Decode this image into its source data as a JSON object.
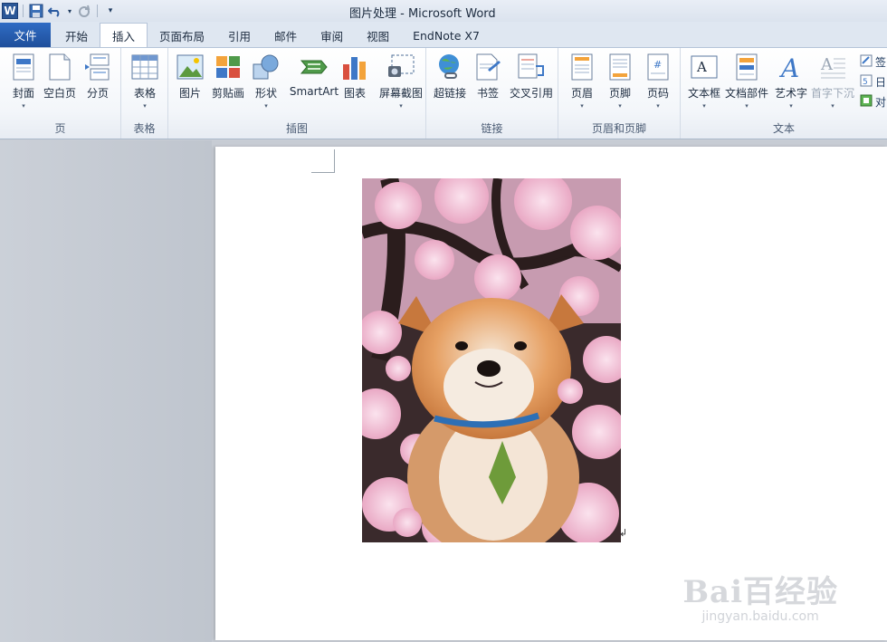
{
  "window": {
    "title": "图片处理 - Microsoft Word"
  },
  "tabs": [
    {
      "label": "文件"
    },
    {
      "label": "开始"
    },
    {
      "label": "插入"
    },
    {
      "label": "页面布局"
    },
    {
      "label": "引用"
    },
    {
      "label": "邮件"
    },
    {
      "label": "审阅"
    },
    {
      "label": "视图"
    },
    {
      "label": "EndNote X7"
    }
  ],
  "groups": {
    "page": {
      "label": "页",
      "buttons": [
        "封面",
        "空白页",
        "分页"
      ]
    },
    "table": {
      "label": "表格",
      "buttons": [
        "表格"
      ]
    },
    "illustrations": {
      "label": "插图",
      "buttons": [
        "图片",
        "剪贴画",
        "形状",
        "SmartArt",
        "图表",
        "屏幕截图"
      ]
    },
    "links": {
      "label": "链接",
      "buttons": [
        "超链接",
        "书签",
        "交叉引用"
      ]
    },
    "headerfooter": {
      "label": "页眉和页脚",
      "buttons": [
        "页眉",
        "页脚",
        "页码"
      ]
    },
    "text": {
      "label": "文本",
      "buttons": [
        "文本框",
        "文档部件",
        "艺术字",
        "首字下沉"
      ],
      "small": [
        "签",
        "日",
        "对"
      ]
    }
  },
  "watermark": {
    "main": "Bai百经验",
    "sub": "jingyan.baidu.com"
  },
  "colors": {
    "file_tab": "#2f6cc4",
    "ribbon_bg": "#f3f6fa",
    "workspace": "#c7ccd4"
  }
}
